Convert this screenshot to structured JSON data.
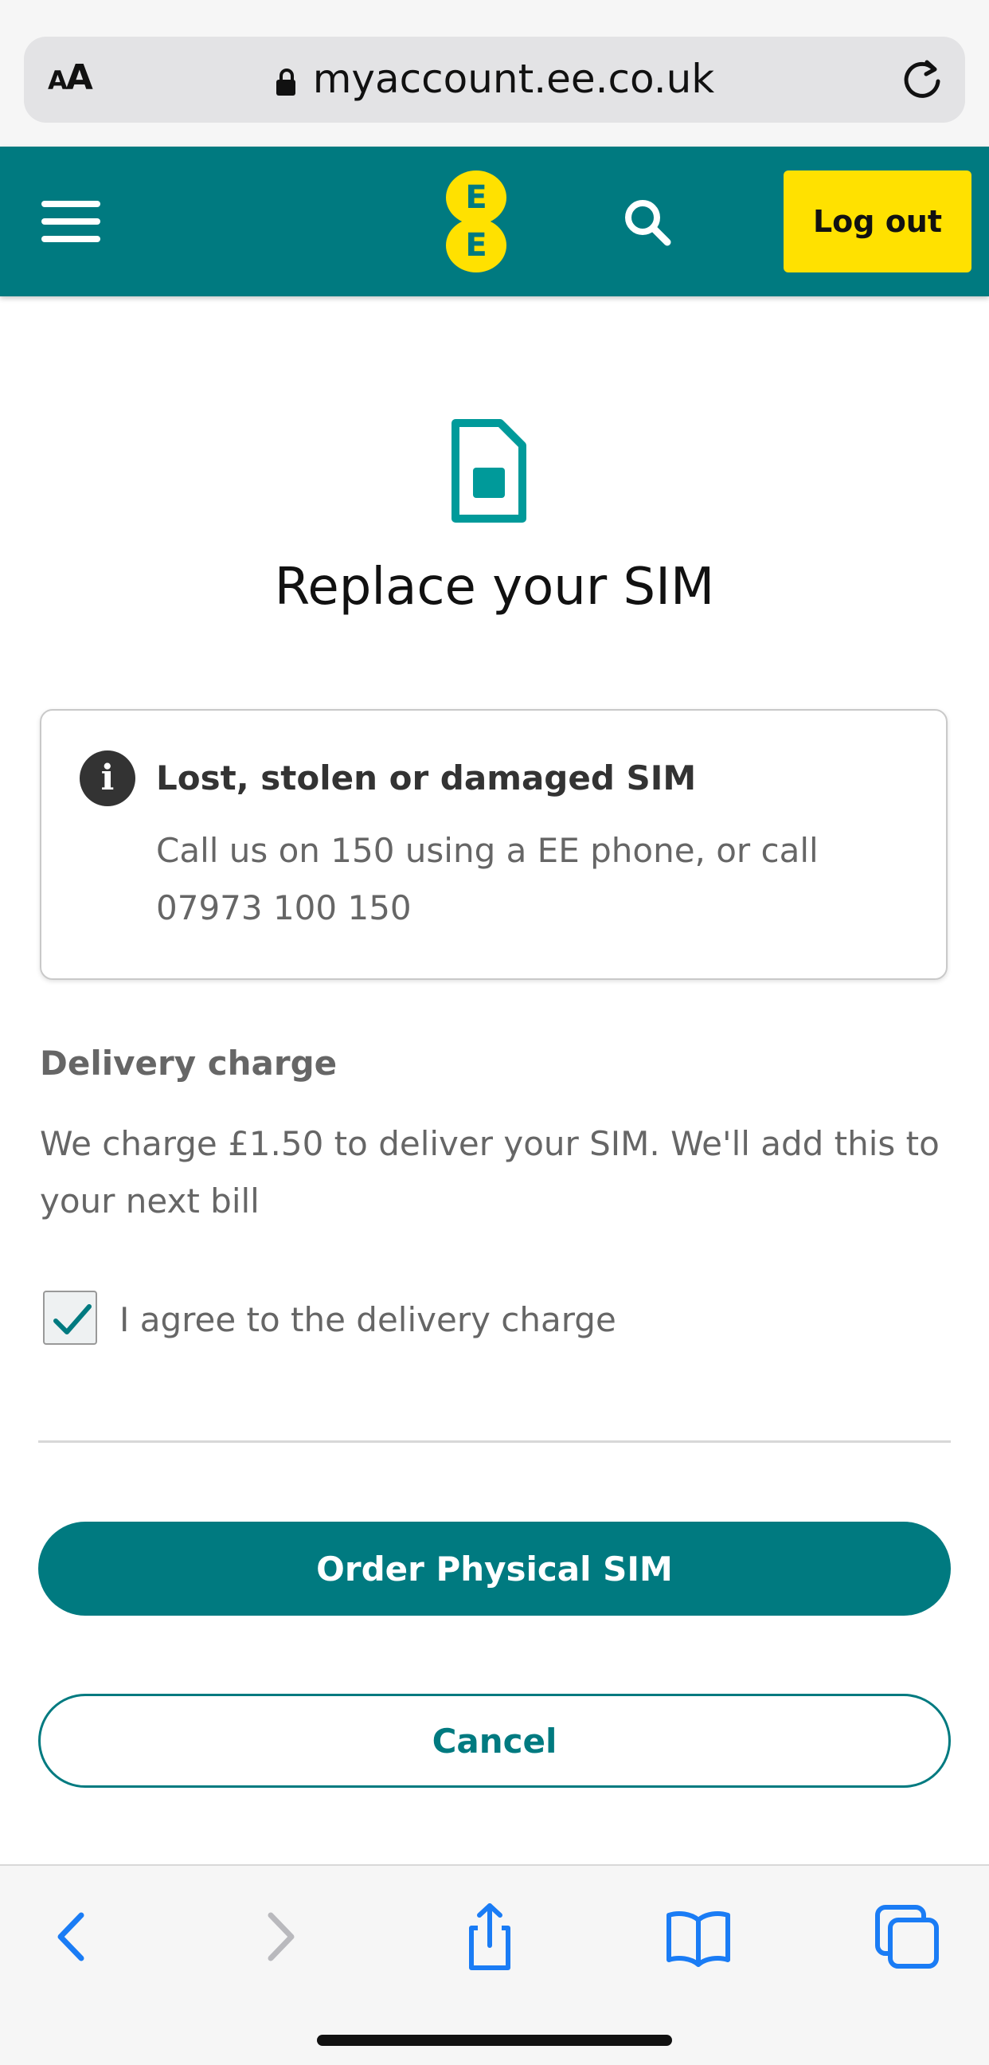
{
  "browser": {
    "text_size_label": "AA",
    "url": "myaccount.ee.co.uk"
  },
  "header": {
    "logo_letters": [
      "E",
      "E"
    ],
    "logout_label": "Log out",
    "colors": {
      "primary": "#007a80",
      "accent": "#ffe100"
    }
  },
  "main": {
    "title": "Replace your SIM",
    "info_card": {
      "title": "Lost, stolen or damaged SIM",
      "body": "Call us on 150 using a EE phone, or call 07973 100 150"
    },
    "delivery": {
      "heading": "Delivery charge",
      "text": "We charge £1.50 to deliver your SIM. We'll add this to your next bill",
      "agree_label": "I agree to the delivery charge",
      "agree_checked": true
    },
    "primary_button": "Order Physical SIM",
    "secondary_button": "Cancel"
  },
  "toolbar": {
    "icons": [
      "back-icon",
      "forward-icon",
      "share-icon",
      "bookmarks-icon",
      "tabs-icon"
    ]
  }
}
